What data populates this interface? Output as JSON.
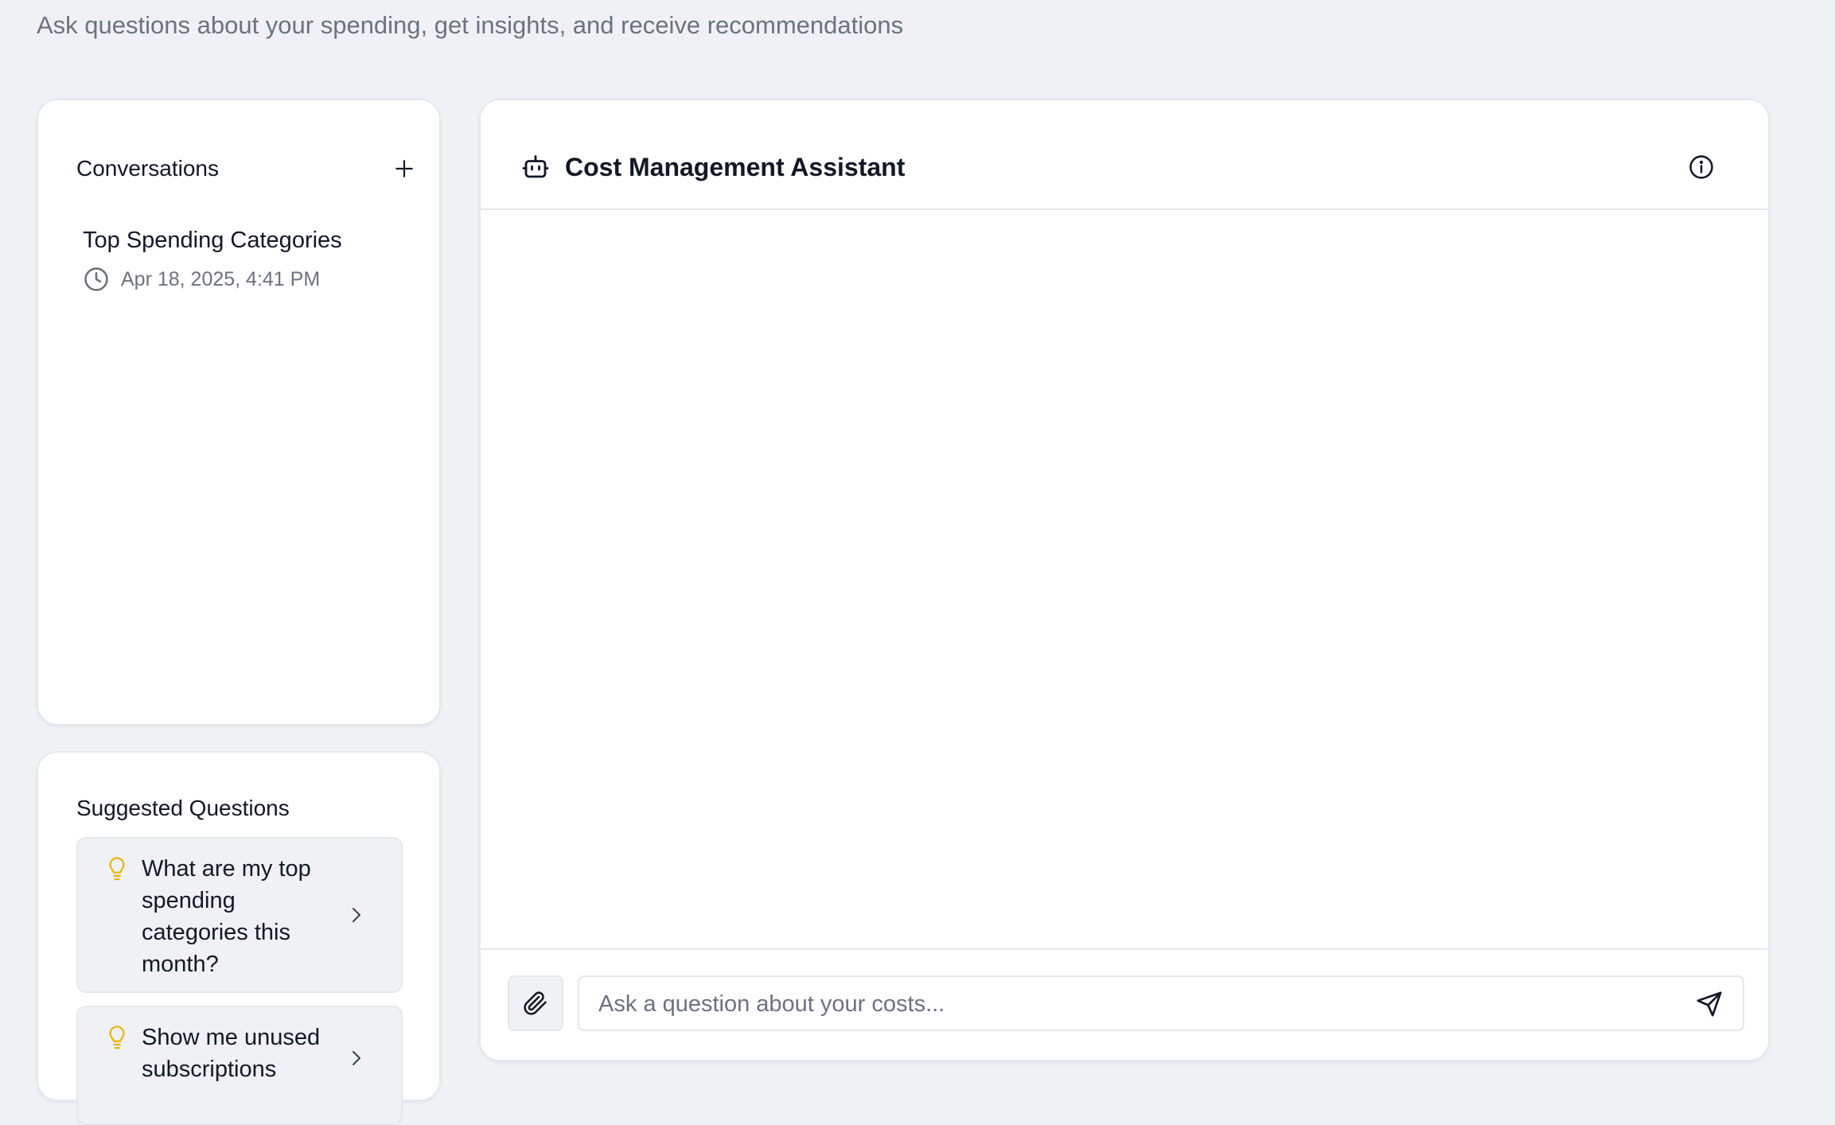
{
  "page": {
    "subtitle": "Ask questions about your spending, get insights, and receive recommendations"
  },
  "sidebar": {
    "conversations": {
      "title": "Conversations",
      "new_icon": "plus-icon",
      "items": [
        {
          "title": "Top Spending Categories",
          "timestamp": "Apr 18, 2025, 4:41 PM",
          "icon": "clock-icon"
        }
      ]
    },
    "suggested": {
      "title": "Suggested Questions",
      "icon": "lightbulb-icon",
      "items": [
        {
          "text": "What are my top spending categories this month?"
        },
        {
          "text": "Show me unused subscriptions"
        }
      ]
    }
  },
  "chat": {
    "title": "Cost Management Assistant",
    "title_icon": "bot-icon",
    "info_icon": "info-icon",
    "input": {
      "placeholder": "Ask a question about your costs...",
      "value": ""
    },
    "attach_icon": "paperclip-icon",
    "send_icon": "send-icon"
  },
  "colors": {
    "background": "#f0f1f5",
    "card": "#ffffff",
    "border": "#e5e7eb",
    "text_primary": "#111827",
    "text_muted": "#6b7280",
    "accent_bulb": "#eab308"
  }
}
